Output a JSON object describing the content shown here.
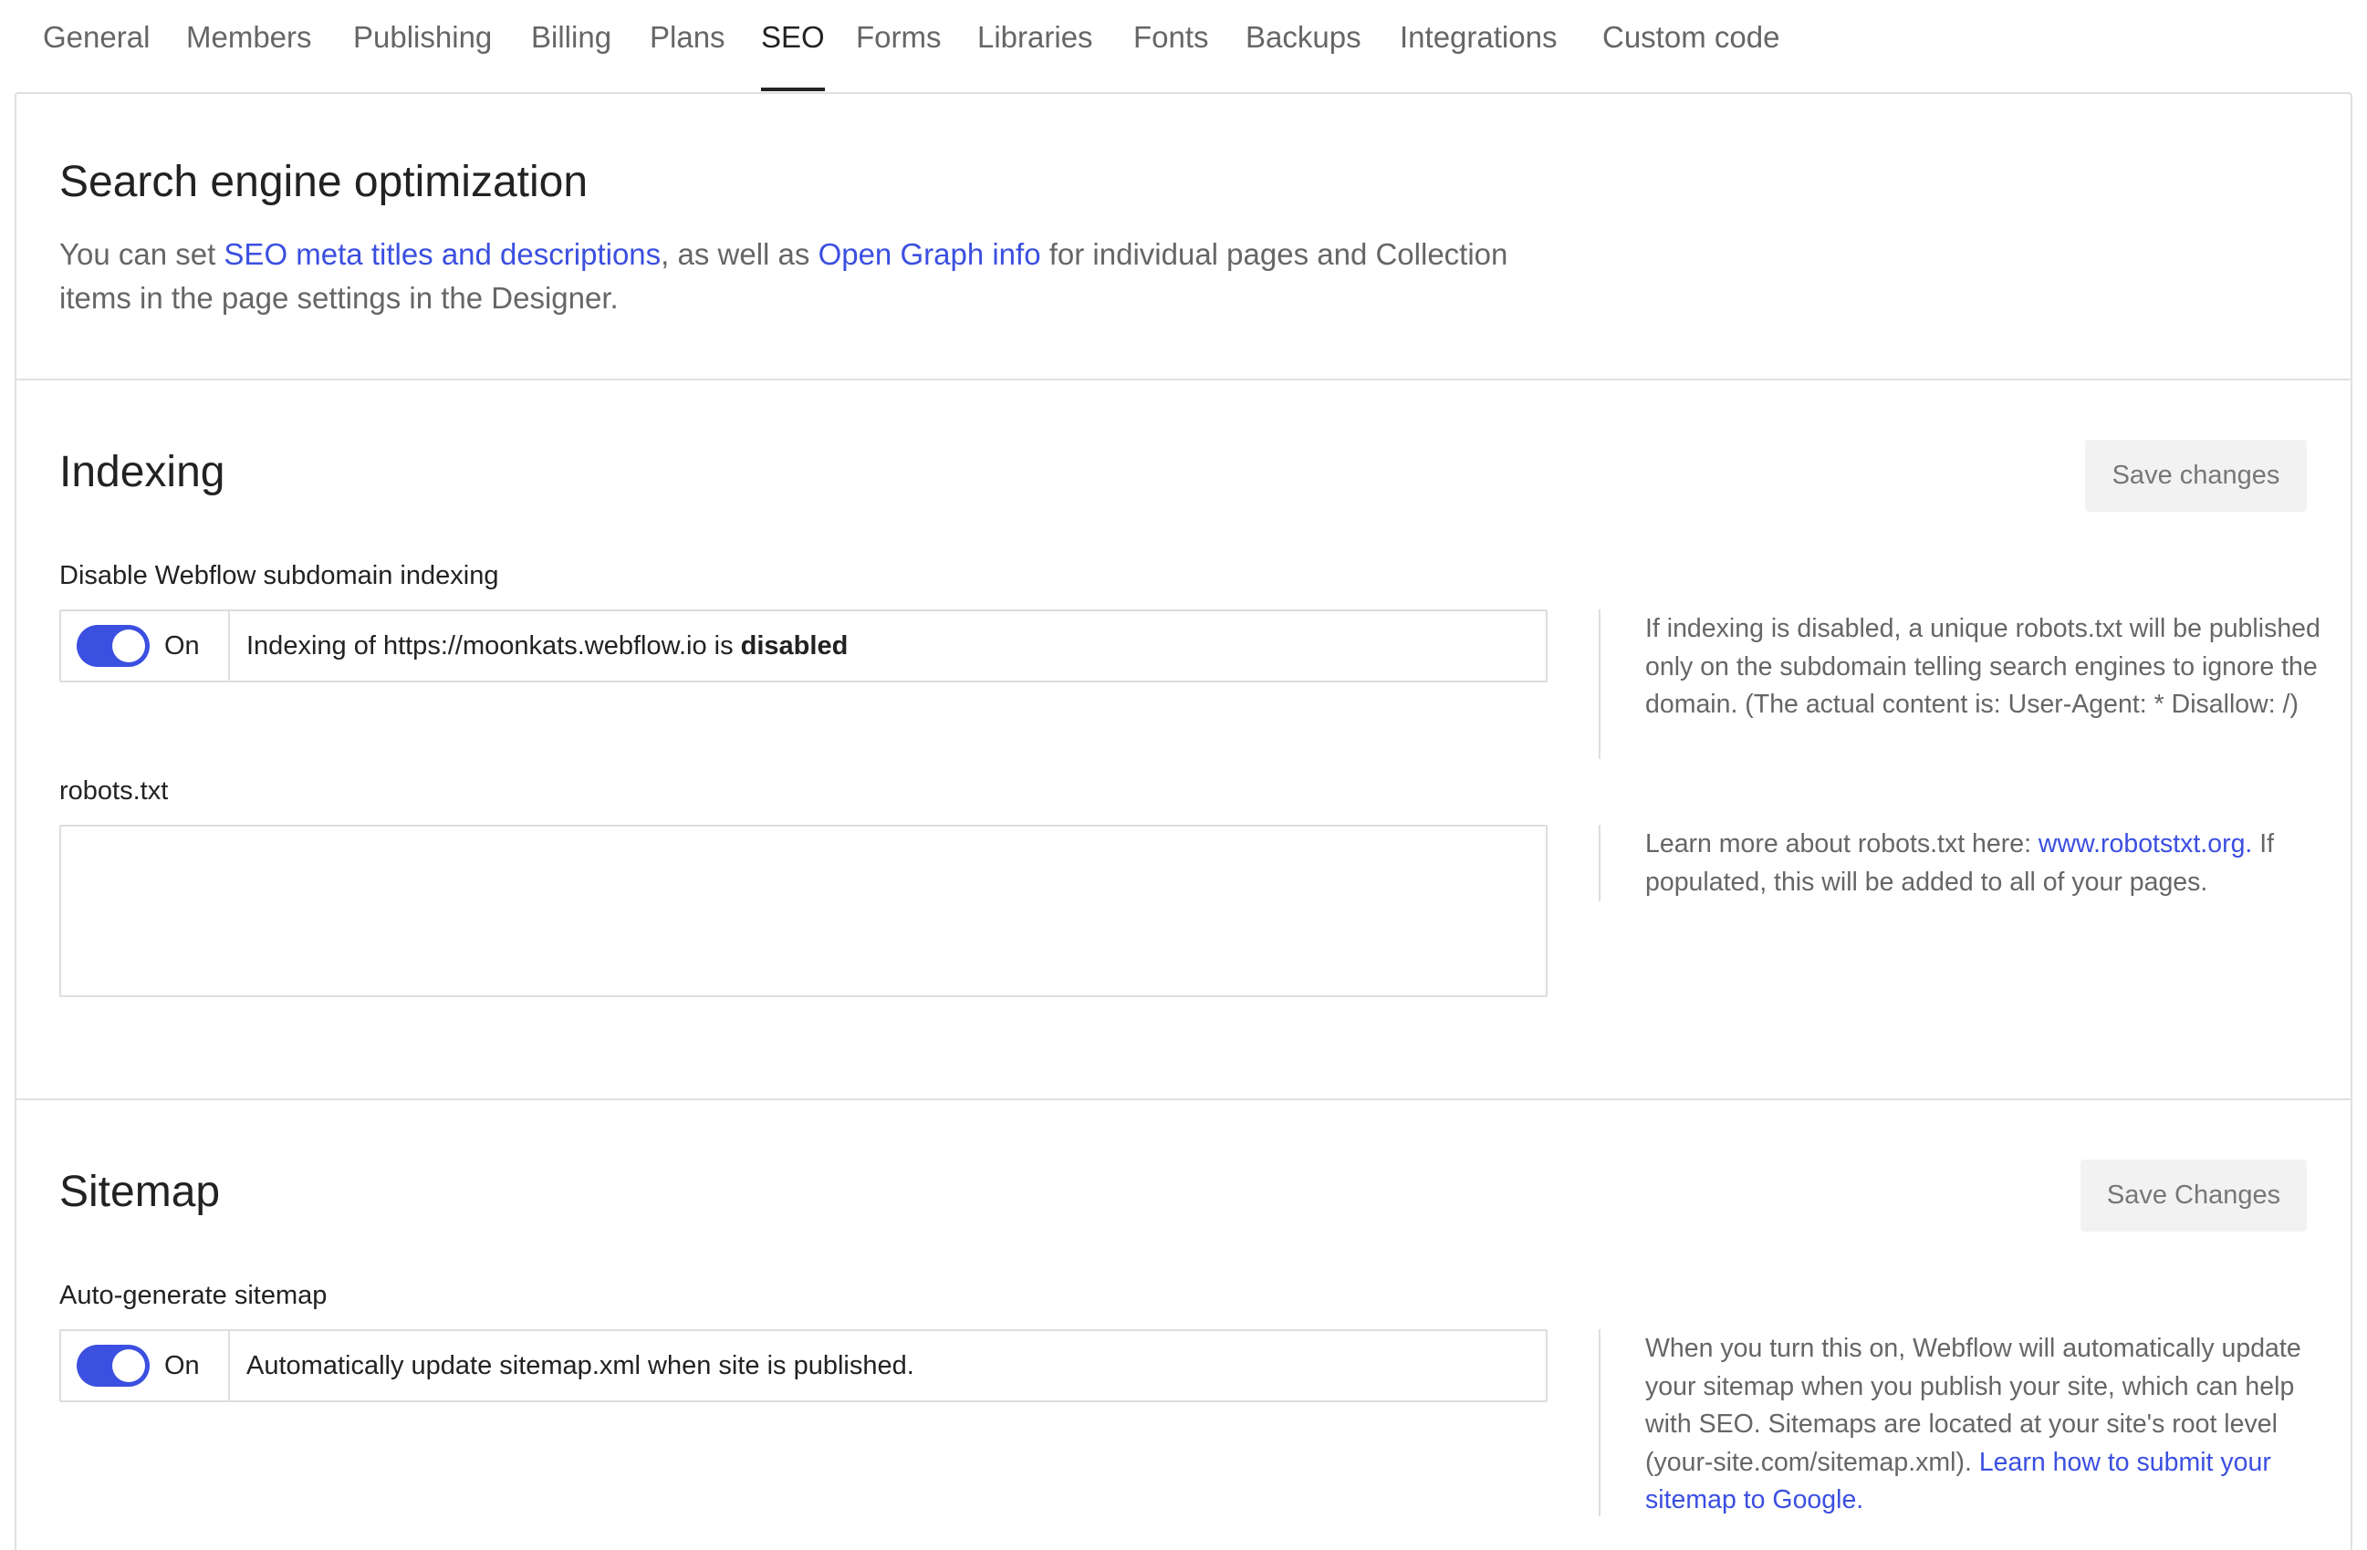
{
  "tabs": [
    {
      "label": "General",
      "active": false
    },
    {
      "label": "Members",
      "active": false
    },
    {
      "label": "Publishing",
      "active": false
    },
    {
      "label": "Billing",
      "active": false
    },
    {
      "label": "Plans",
      "active": false
    },
    {
      "label": "SEO",
      "active": true
    },
    {
      "label": "Forms",
      "active": false
    },
    {
      "label": "Libraries",
      "active": false
    },
    {
      "label": "Fonts",
      "active": false
    },
    {
      "label": "Backups",
      "active": false
    },
    {
      "label": "Integrations",
      "active": false
    },
    {
      "label": "Custom code",
      "active": false
    }
  ],
  "seo": {
    "title": "Search engine optimization",
    "desc_part1": "You can set ",
    "desc_link1": "SEO meta titles and descriptions",
    "desc_part2": ", as well as ",
    "desc_link2": "Open Graph info",
    "desc_part3": " for individual pages and Collection items in the page settings in the Designer."
  },
  "indexing": {
    "title": "Indexing",
    "save_label": "Save changes",
    "field_label": "Disable Webflow subdomain indexing",
    "toggle_state": "On",
    "toggle_text_prefix": "Indexing of https://moonkats.webflow.io is ",
    "toggle_text_bold": "disabled",
    "help_text": "If indexing is disabled, a unique robots.txt will be published only on the subdomain telling search engines to ignore the domain. (The actual content is: User-Agent: * Disallow: /)",
    "robots_label": "robots.txt",
    "robots_value": "",
    "robots_help_prefix": "Learn more about robots.txt here: ",
    "robots_help_link": "www.robotstxt.org.",
    "robots_help_suffix": " If populated, this will be added to all of your pages."
  },
  "sitemap": {
    "title": "Sitemap",
    "save_label": "Save Changes",
    "field_label": "Auto-generate sitemap",
    "toggle_state": "On",
    "toggle_text": "Automatically update sitemap.xml when site is published.",
    "help_text": "When you turn this on, Webflow will automatically update your sitemap when you publish your site, which can help with SEO. Sitemaps are located at your site's root level (your-site.com/sitemap.xml). ",
    "help_link": "Learn how to submit your sitemap to Google."
  },
  "colors": {
    "accent": "#3b4fe0",
    "text": "#222222",
    "muted": "#666666",
    "border": "#e0e0e0"
  }
}
